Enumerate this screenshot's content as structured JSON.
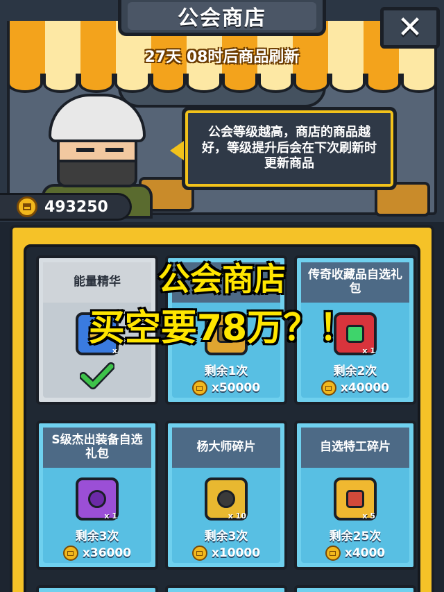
{
  "header": {
    "title": "公会商店",
    "close_icon": "close-icon",
    "refresh_text": "27天 08时后商品刷新"
  },
  "shopkeeper": {
    "speech": "公会等级越高，商店的商品越好，等级提升后会在下次刷新时更新商品"
  },
  "currency": {
    "icon": "guild-coin-icon",
    "amount": "493250"
  },
  "caption": {
    "line1": "公会商店",
    "line2": "买空要78万？！"
  },
  "items": [
    {
      "name": "能量精华",
      "sold_out": true,
      "qty": "x",
      "icon_color": "#3a7be0",
      "gem_color": "#e6b53a"
    },
    {
      "name": "",
      "remaining": "剩余1次",
      "price": "x50000",
      "icon_color": "#e0a530",
      "gem_color": "#8b6b2a"
    },
    {
      "name": "传奇收藏品自选礼包",
      "remaining": "剩余2次",
      "price": "x40000",
      "qty": "x 1",
      "icon_color": "#d8343c",
      "gem_color": "#3ed46b"
    },
    {
      "name": "S级杰出装备自选礼包",
      "remaining": "剩余3次",
      "price": "x36000",
      "qty": "x 1",
      "icon_color": "#9b4fd6",
      "gem_color": "#6c2aa8"
    },
    {
      "name": "杨大师碎片",
      "remaining": "剩余3次",
      "price": "x10000",
      "qty": "x 10",
      "icon_color": "#e8b830",
      "gem_color": "#3a3a3a"
    },
    {
      "name": "自选特工碎片",
      "remaining": "剩余25次",
      "price": "x4000",
      "qty": "x 5",
      "icon_color": "#f0b830",
      "gem_color": "#d24a3a"
    }
  ],
  "colors": {
    "accent_yellow": "#f5c228",
    "card_blue": "#6fd0ee",
    "caption_yellow": "#ffe600"
  }
}
